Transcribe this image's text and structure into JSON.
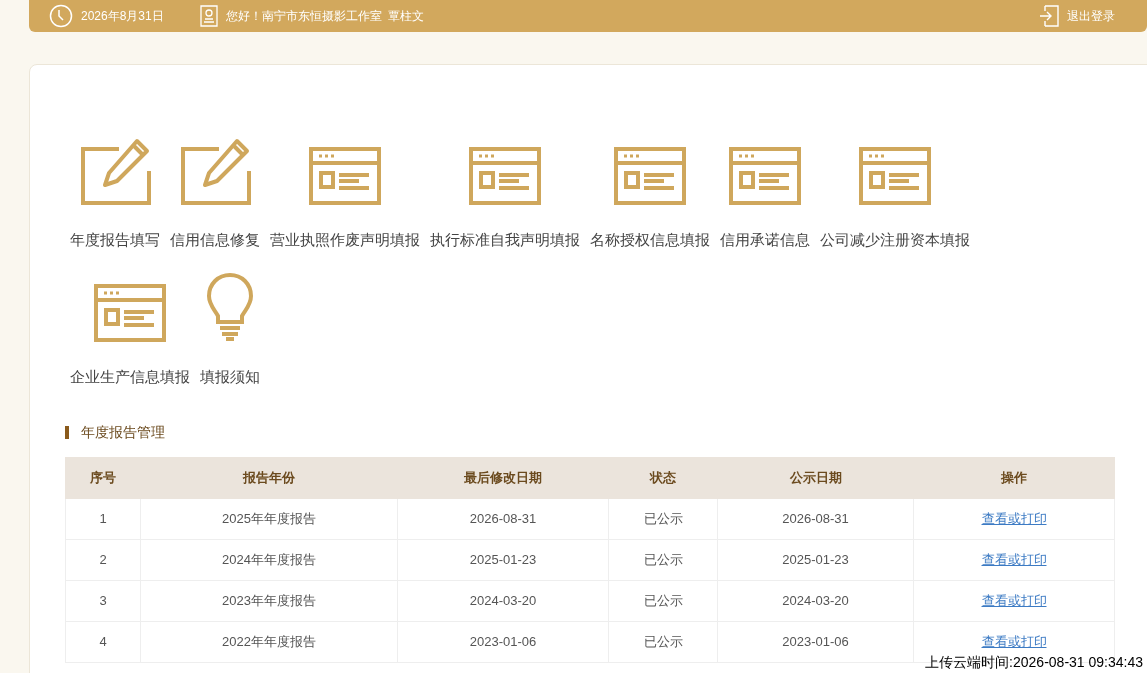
{
  "header": {
    "date": "2026年8月31日",
    "greeting": "您好！南宁市东恒摄影工作室  覃柱文",
    "logout": "退出登录"
  },
  "tiles": [
    {
      "kind": "edit",
      "label": "年度报告填写"
    },
    {
      "kind": "edit",
      "label": "信用信息修复"
    },
    {
      "kind": "form",
      "label": "营业执照作废声明填报"
    },
    {
      "kind": "form",
      "label": "执行标准自我声明填报"
    },
    {
      "kind": "form",
      "label": "名称授权信息填报"
    },
    {
      "kind": "form",
      "label": "信用承诺信息"
    },
    {
      "kind": "form",
      "label": "公司减少注册资本填报"
    },
    {
      "kind": "form",
      "label": "企业生产信息填报"
    },
    {
      "kind": "bulb",
      "label": "填报须知"
    }
  ],
  "section_title": "年度报告管理",
  "table": {
    "columns": [
      "序号",
      "报告年份",
      "最后修改日期",
      "状态",
      "公示日期",
      "操作"
    ],
    "rows": [
      [
        "1",
        "2025年年度报告",
        "2026-08-31",
        "已公示",
        "2026-08-31",
        "查看或打印"
      ],
      [
        "2",
        "2024年年度报告",
        "2025-01-23",
        "已公示",
        "2025-01-23",
        "查看或打印"
      ],
      [
        "3",
        "2023年年度报告",
        "2024-03-20",
        "已公示",
        "2024-03-20",
        "查看或打印"
      ],
      [
        "4",
        "2022年年度报告",
        "2023-01-06",
        "已公示",
        "2023-01-06",
        "查看或打印"
      ]
    ]
  },
  "upload_stamp": "上传云端时间:2026-08-31 09:34:43"
}
